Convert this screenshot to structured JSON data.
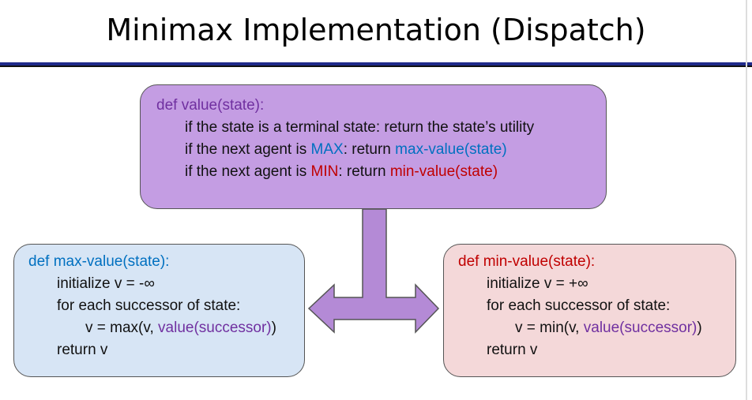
{
  "title": "Minimax Implementation (Dispatch)",
  "colors": {
    "value_box": "#c49de3",
    "max_box": "#d7e5f5",
    "min_box": "#f4d8d9",
    "purple_text": "#7030a0",
    "blue_text": "#0070c0",
    "red_text": "#c00000",
    "arrow": "#b48ad6"
  },
  "value_box": {
    "def": "def value(state):",
    "terminal": "if the state is a terminal state: return the state’s utility",
    "max_prefix": "if the next agent is ",
    "max_word": "MAX",
    "max_mid": ": return ",
    "max_call": "max-value(state)",
    "min_prefix": "if the next agent is ",
    "min_word": "MIN",
    "min_mid": ": return ",
    "min_call": "min-value(state)"
  },
  "max_box": {
    "def": "def max-value(state):",
    "init": "initialize v = -∞",
    "loop": "for each successor of state:",
    "assign_prefix": "v = max(v, ",
    "assign_call": "value(successor)",
    "assign_suffix": ")",
    "ret": "return v"
  },
  "min_box": {
    "def": "def min-value(state):",
    "init": "initialize v = +∞",
    "loop": "for each successor of state:",
    "assign_prefix": "v = min(v, ",
    "assign_call": "value(successor)",
    "assign_suffix": ")",
    "ret": "return v"
  }
}
